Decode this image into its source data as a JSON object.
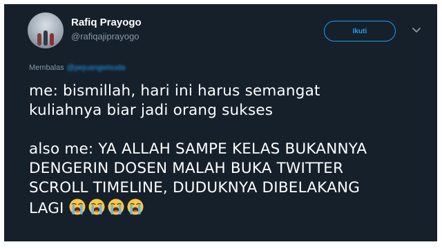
{
  "tweet": {
    "display_name": "Rafiq Prayogo",
    "handle": "@rafiqajiprayogo",
    "follow_label": "Ikuti",
    "reply_prefix": "Membalas",
    "reply_mention": "@pejuangwisuda",
    "lines": [
      "me: bismillah, hari ini harus semangat",
      "kuliahnya biar jadi orang sukses",
      "",
      "also me: YA ALLAH SAMPE KELAS BUKANNYA",
      "DENGERIN DOSEN MALAH BUKA TWITTER",
      "SCROLL TIMELINE, DUDUKNYA DIBELAKANG",
      "LAGI"
    ],
    "emojis": [
      "loudly-crying-face",
      "loudly-crying-face",
      "loudly-crying-face",
      "loudly-crying-face"
    ]
  },
  "colors": {
    "background": "#15202b",
    "text": "#ffffff",
    "secondary": "#8899a6",
    "accent": "#1da1f2",
    "emoji_face": "#f7c948",
    "emoji_tears": "#5fb6f0"
  },
  "icons": {
    "menu": "chevron-down-icon",
    "avatar": "avatar-photo"
  }
}
